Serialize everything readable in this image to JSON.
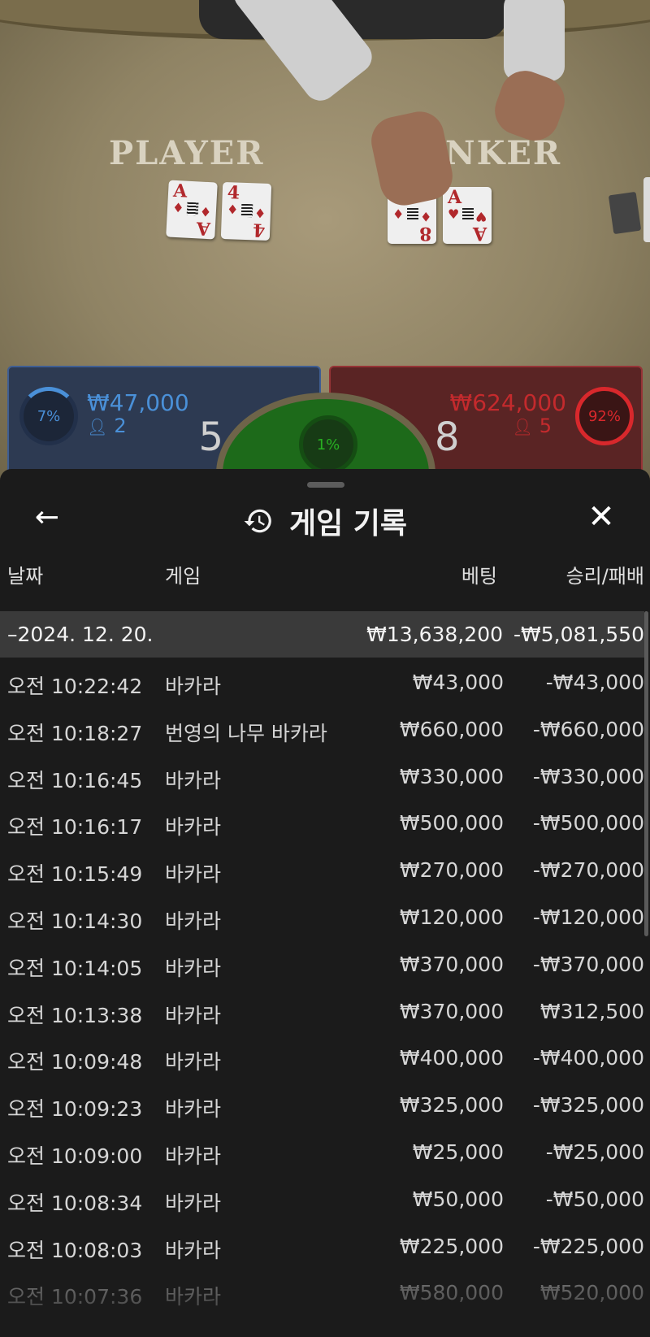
{
  "table": {
    "player_label": "PLAYER",
    "banker_label": "NKER",
    "player_cards": [
      {
        "rank": "A",
        "suit": "♦"
      },
      {
        "rank": "4",
        "suit": "♦"
      }
    ],
    "banker_cards": [
      {
        "rank": "8",
        "suit": "♦"
      },
      {
        "rank": "A",
        "suit": "♥"
      }
    ]
  },
  "bets": {
    "player": {
      "percent": "7%",
      "amount": "₩47,000",
      "count": "2",
      "score": "5",
      "color": "#4a90d8"
    },
    "tie": {
      "percent": "1%",
      "color": "#28b022"
    },
    "banker": {
      "percent": "92%",
      "amount": "₩624,000",
      "count": "5",
      "score": "8",
      "color": "#d8282c"
    }
  },
  "history": {
    "title": "게임 기록",
    "back_icon": "arrow-left-icon",
    "history_icon": "history-clock-icon",
    "close_icon": "close-icon",
    "columns": {
      "date": "날짜",
      "game": "게임",
      "bet": "베팅",
      "result": "승리/패배"
    },
    "date_group": {
      "label": "–2024. 12. 20.",
      "bet": "₩13,638,200",
      "result": "-₩5,081,550"
    },
    "rows": [
      {
        "time": "오전 10:22:42",
        "game": "바카라",
        "bet": "₩43,000",
        "result": "-₩43,000"
      },
      {
        "time": "오전 10:18:27",
        "game": "번영의 나무 바카라",
        "bet": "₩660,000",
        "result": "-₩660,000"
      },
      {
        "time": "오전 10:16:45",
        "game": "바카라",
        "bet": "₩330,000",
        "result": "-₩330,000"
      },
      {
        "time": "오전 10:16:17",
        "game": "바카라",
        "bet": "₩500,000",
        "result": "-₩500,000"
      },
      {
        "time": "오전 10:15:49",
        "game": "바카라",
        "bet": "₩270,000",
        "result": "-₩270,000"
      },
      {
        "time": "오전 10:14:30",
        "game": "바카라",
        "bet": "₩120,000",
        "result": "-₩120,000"
      },
      {
        "time": "오전 10:14:05",
        "game": "바카라",
        "bet": "₩370,000",
        "result": "-₩370,000"
      },
      {
        "time": "오전 10:13:38",
        "game": "바카라",
        "bet": "₩370,000",
        "result": "₩312,500"
      },
      {
        "time": "오전 10:09:48",
        "game": "바카라",
        "bet": "₩400,000",
        "result": "-₩400,000"
      },
      {
        "time": "오전 10:09:23",
        "game": "바카라",
        "bet": "₩325,000",
        "result": "-₩325,000"
      },
      {
        "time": "오전 10:09:00",
        "game": "바카라",
        "bet": "₩25,000",
        "result": "-₩25,000"
      },
      {
        "time": "오전 10:08:34",
        "game": "바카라",
        "bet": "₩50,000",
        "result": "-₩50,000"
      },
      {
        "time": "오전 10:08:03",
        "game": "바카라",
        "bet": "₩225,000",
        "result": "-₩225,000"
      },
      {
        "time": "오전 10:07:36",
        "game": "바카라",
        "bet": "₩580,000",
        "result": "₩520,000"
      }
    ]
  }
}
